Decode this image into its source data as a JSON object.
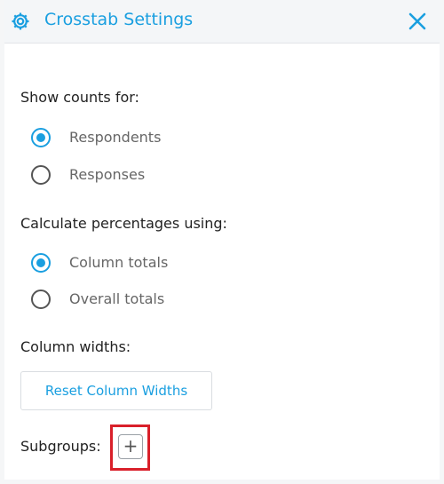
{
  "header": {
    "title": "Crosstab Settings",
    "settings_icon": "gear-icon",
    "close_icon": "close-icon"
  },
  "show_counts": {
    "label": "Show counts for:",
    "options": [
      {
        "label": "Respondents",
        "checked": true
      },
      {
        "label": "Responses",
        "checked": false
      }
    ]
  },
  "percentages": {
    "label": "Calculate percentages using:",
    "options": [
      {
        "label": "Column totals",
        "checked": true
      },
      {
        "label": "Overall totals",
        "checked": false
      }
    ]
  },
  "column_widths": {
    "label": "Column widths:",
    "reset_button": "Reset Column Widths"
  },
  "subgroups": {
    "label": "Subgroups:",
    "add_button": "+"
  },
  "colors": {
    "accent": "#1a9fe0",
    "highlight": "#d9202a"
  }
}
